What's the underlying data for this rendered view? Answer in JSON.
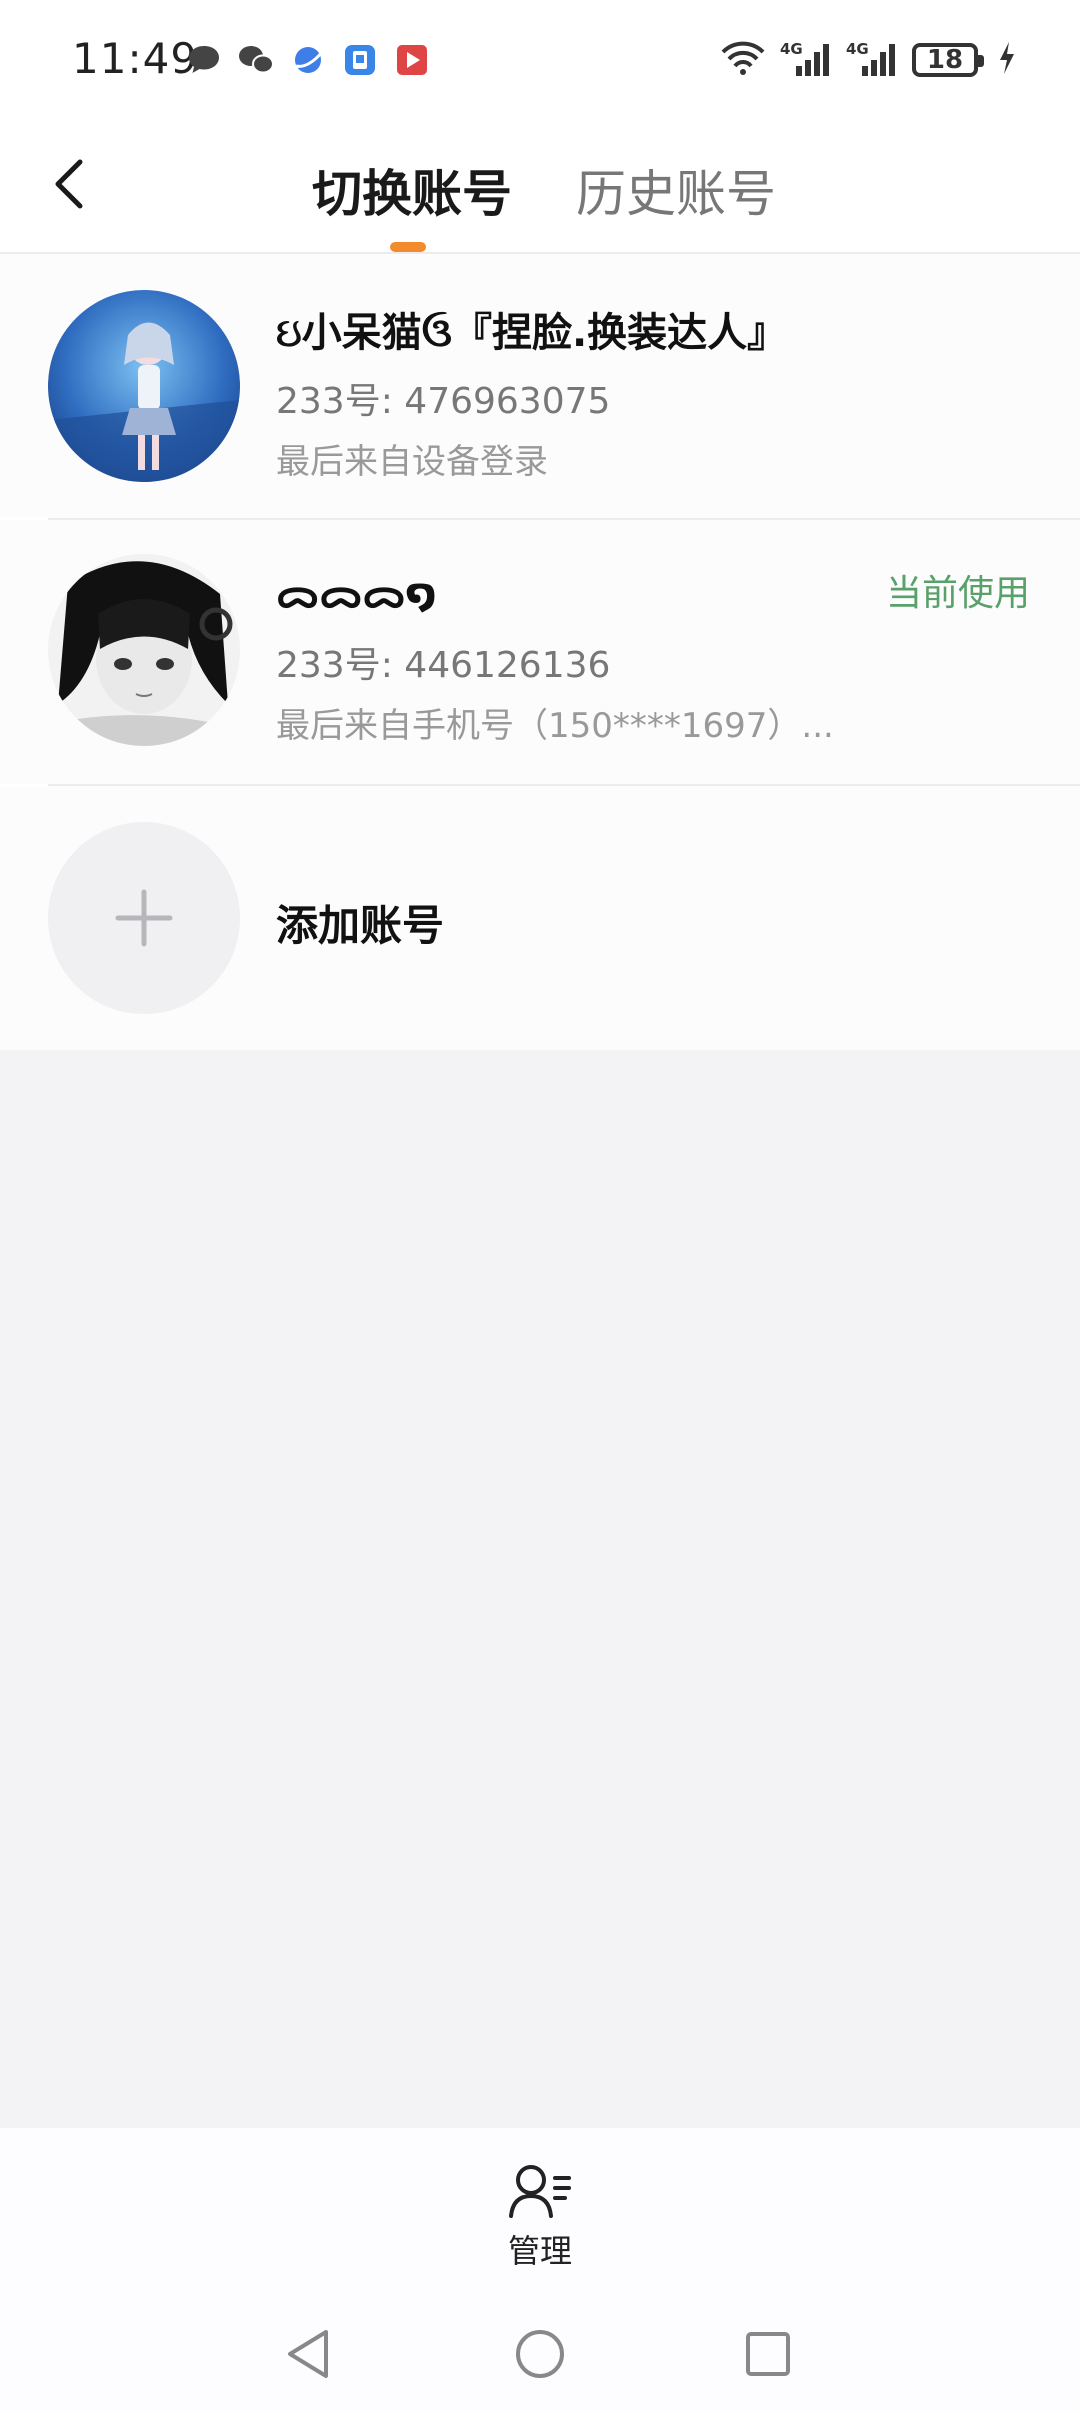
{
  "status_bar": {
    "time": "11:49",
    "battery_level": "18",
    "left_icons": [
      "chat-bubble-icon",
      "wechat-icon",
      "browser-icon",
      "app-icon",
      "video-app-icon"
    ],
    "right_icons": [
      "wifi-icon",
      "signal-4g-icon",
      "signal-4g-icon",
      "battery-icon",
      "charging-icon"
    ]
  },
  "header": {
    "tabs": [
      {
        "label": "切换账号",
        "active": true
      },
      {
        "label": "历史账号",
        "active": false
      }
    ],
    "accent_color": "#f38b2c"
  },
  "accounts": [
    {
      "name": "ઇ小呆猫ઉ『捏脸.换装达人』",
      "id_text": "233号: 476963075",
      "last_login": "最后来自设备登录",
      "current": false
    },
    {
      "name": "ᯅᯅᯅ໑",
      "id_text": "233号: 446126136",
      "last_login": "最后来自手机号（150****1697）...",
      "current": true,
      "current_label": "当前使用",
      "current_color": "#5aa06a"
    }
  ],
  "add_account": {
    "label": "添加账号"
  },
  "bottom_bar": {
    "manage_label": "管理"
  },
  "nav_bar": {
    "buttons": [
      "back-triangle-icon",
      "home-circle-icon",
      "recents-square-icon"
    ]
  }
}
